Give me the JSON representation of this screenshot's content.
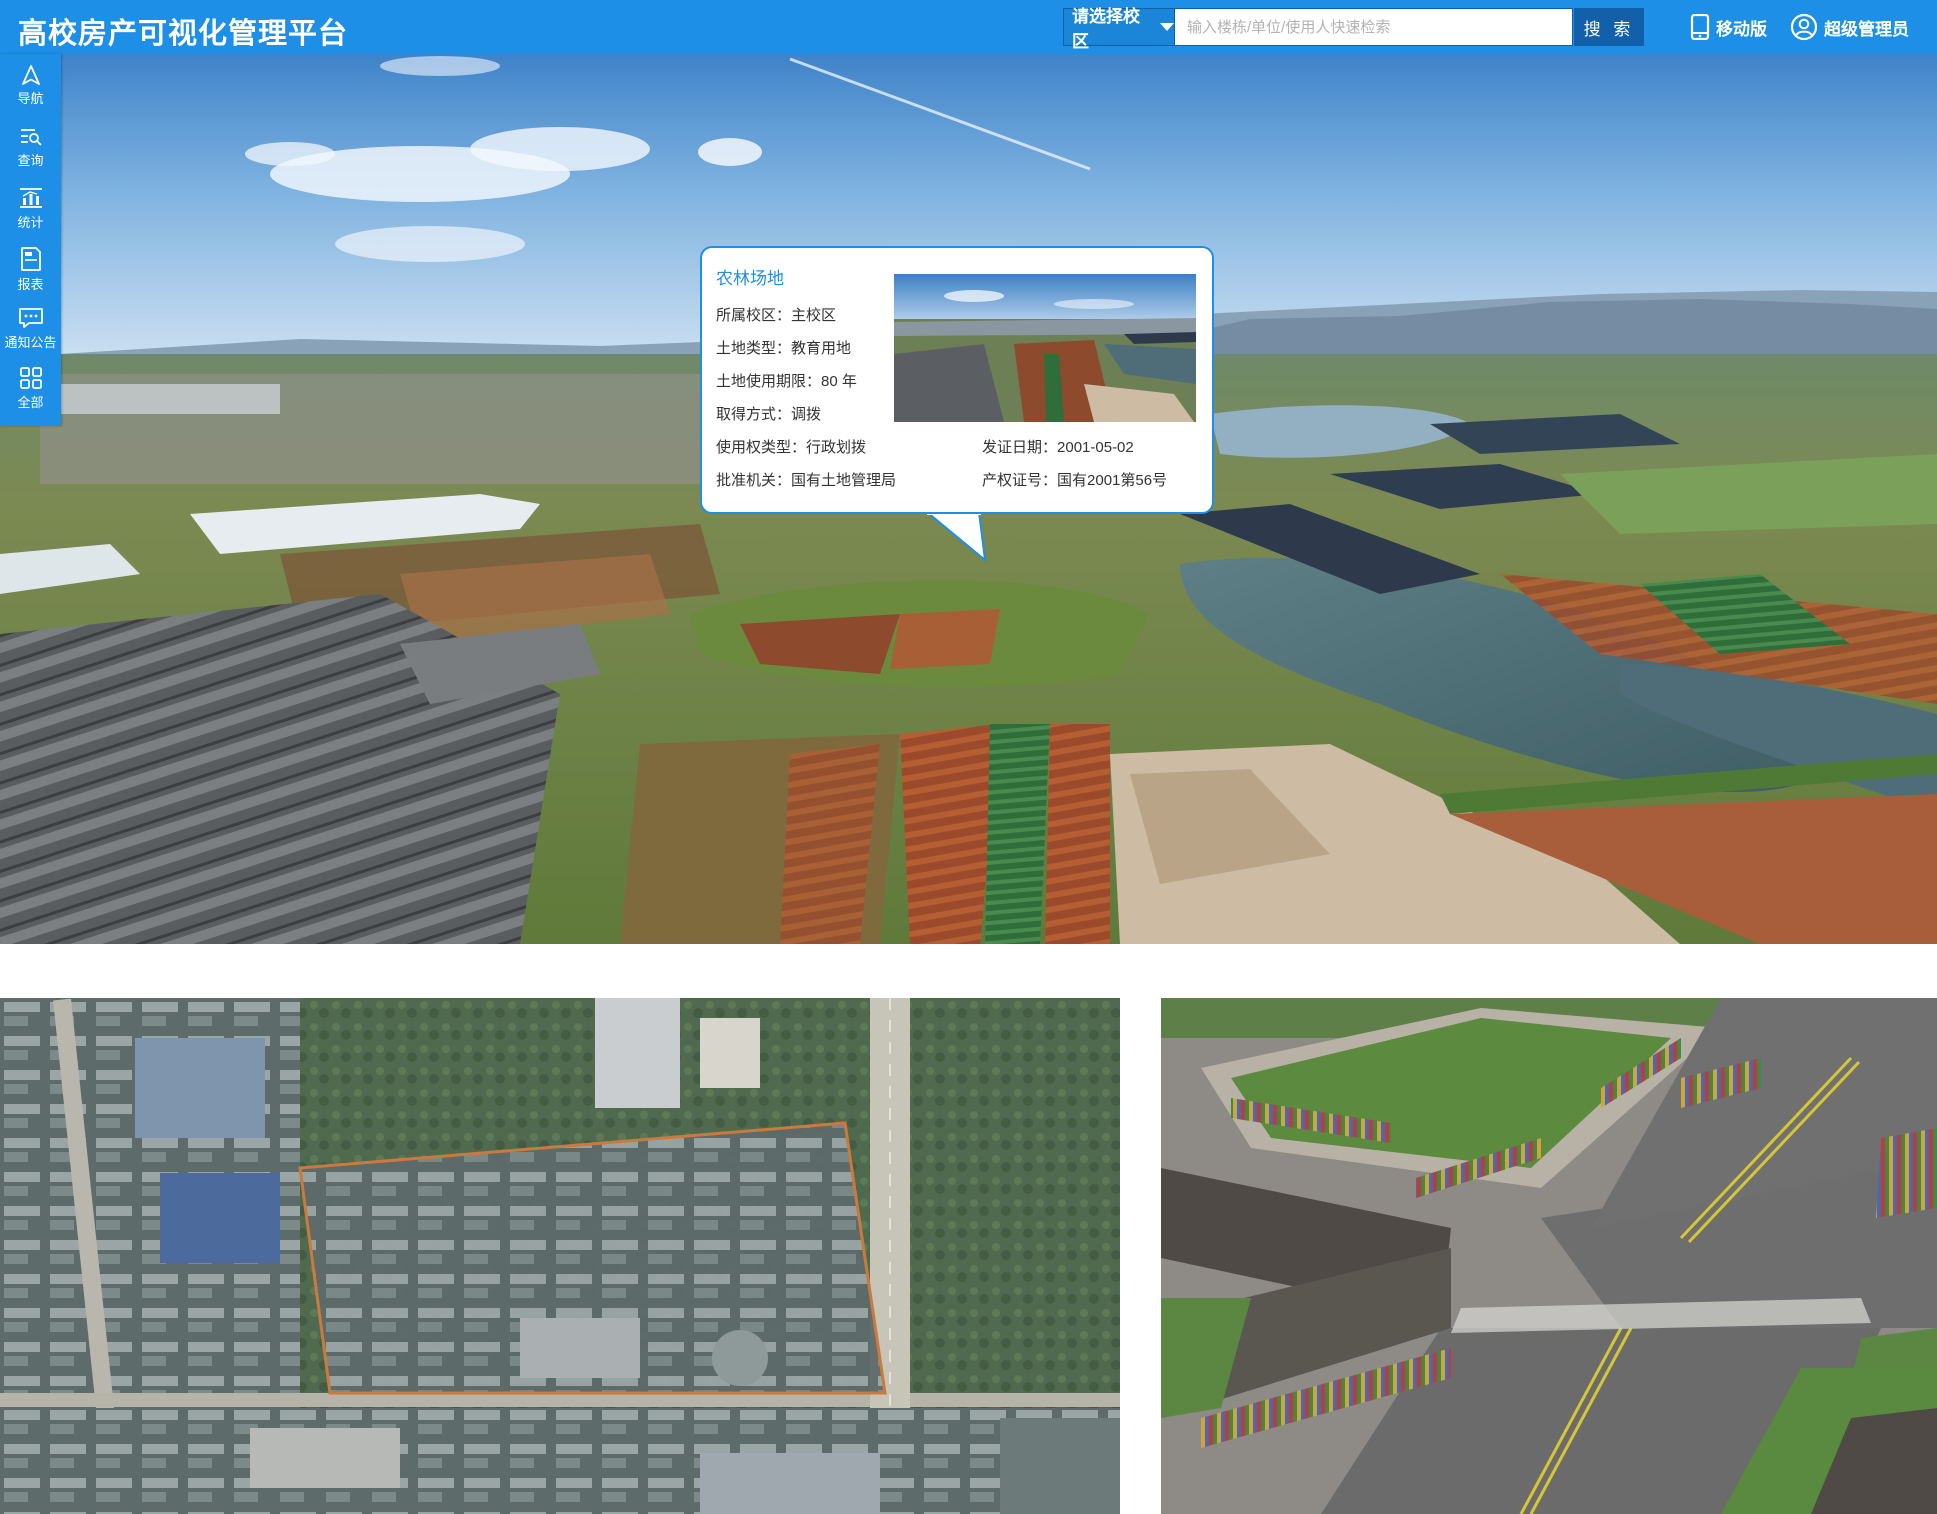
{
  "header": {
    "title": "高校房产可视化管理平台",
    "campus_select": "请选择校区",
    "search_placeholder": "输入楼栋/单位/使用人快速检索",
    "search_button": "搜 索",
    "mobile_link": "移动版",
    "admin_link": "超级管理员"
  },
  "toolbar": {
    "items": [
      {
        "label": "导航",
        "icon": "navigation-arrow-icon"
      },
      {
        "label": "查询",
        "icon": "search-list-icon"
      },
      {
        "label": "统计",
        "icon": "statistics-icon"
      },
      {
        "label": "报表",
        "icon": "report-icon"
      },
      {
        "label": "通知公告",
        "icon": "message-icon"
      },
      {
        "label": "全部",
        "icon": "grid-icon"
      }
    ]
  },
  "popup": {
    "title": "农林场地",
    "fields": [
      {
        "label": "所属校区：",
        "value": "主校区"
      },
      {
        "label": "土地类型：",
        "value": "教育用地"
      },
      {
        "label": "土地使用期限：",
        "value": "80 年"
      },
      {
        "label": "取得方式：",
        "value": "调拨"
      },
      {
        "label": "使用权类型：",
        "value": "行政划拨"
      },
      {
        "label": "批准机关：",
        "value": "国有土地管理局"
      },
      {
        "label": "发证日期：",
        "value": "2001-05-02"
      },
      {
        "label": "产权证号：",
        "value": "国有2001第56号"
      }
    ]
  },
  "colors": {
    "primary": "#1d8fe6",
    "search_button": "#1360aa"
  }
}
